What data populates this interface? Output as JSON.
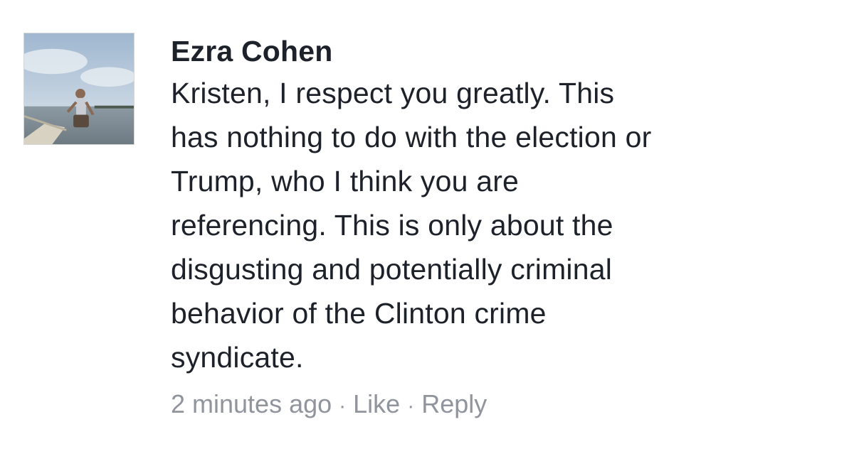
{
  "comment": {
    "author": "Ezra Cohen",
    "text_lines": [
      "Kristen, I respect you greatly.  This",
      "has nothing to do with the election or",
      "Trump, who I think you are",
      "referencing. This is only about the",
      "disgusting and potentially criminal",
      "behavior of the Clinton crime",
      "syndicate."
    ],
    "timestamp": "2 minutes ago",
    "separator": "·",
    "like_label": "Like",
    "reply_label": "Reply",
    "avatar_icon": "profile-photo"
  },
  "colors": {
    "text": "#1d2129",
    "meta": "#90949c"
  }
}
